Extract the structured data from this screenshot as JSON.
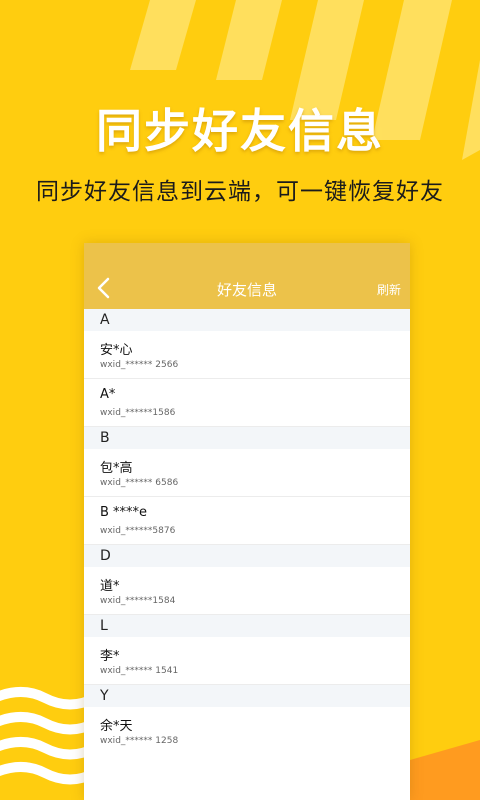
{
  "headline": "同步好友信息",
  "subline": "同步好友信息到云端，可一键恢复好友",
  "colors": {
    "background": "#ffcd0f",
    "appbar": "#ecc24a",
    "section_bg": "#f3f6f9"
  },
  "appbar": {
    "back_icon": "chevron-left-icon",
    "title": "好友信息",
    "refresh_label": "刷新"
  },
  "sections": [
    {
      "letter": "A",
      "contacts": [
        {
          "name": "安*心",
          "wxid": "wxid_****** 2566"
        },
        {
          "name": "A*",
          "wxid": "wxid_******1586"
        }
      ]
    },
    {
      "letter": "B",
      "contacts": [
        {
          "name": "包*高",
          "wxid": "wxid_****** 6586"
        },
        {
          "name": "B ****e",
          "wxid": "wxid_******5876"
        }
      ]
    },
    {
      "letter": "D",
      "contacts": [
        {
          "name": "道*",
          "wxid": "wxid_******1584"
        }
      ]
    },
    {
      "letter": "L",
      "contacts": [
        {
          "name": "李*",
          "wxid": "wxid_****** 1541"
        }
      ]
    },
    {
      "letter": "Y",
      "contacts": [
        {
          "name": "余*天",
          "wxid": "wxid_****** 1258"
        }
      ]
    }
  ]
}
